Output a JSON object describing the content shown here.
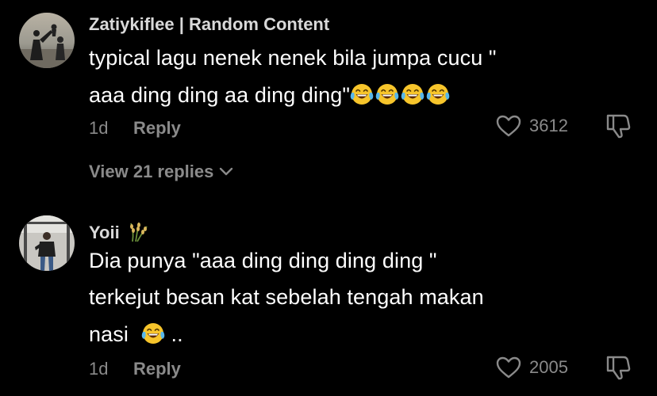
{
  "comments": [
    {
      "username": "Zatiykiflee | Random Content",
      "line1": "typical lagu nenek nenek bila jumpa cucu \"",
      "line2": "aaa ding ding aa ding ding\"",
      "time": "1d",
      "reply_label": "Reply",
      "likes": "3612",
      "view_replies": "View 21 replies"
    },
    {
      "username": "Yoii",
      "line1": "Dia punya \"aaa ding ding ding ding \"",
      "line2": "terkejut besan kat sebelah tengah makan",
      "line3_prefix": "nasi",
      "line3_suffix": "..",
      "time": "1d",
      "reply_label": "Reply",
      "likes": "2005"
    }
  ],
  "icons": {
    "like": "heart-outline-icon",
    "dislike": "thumbs-down-icon",
    "emoji": "face-with-tears-of-joy",
    "username_badge": "rice-sheaf"
  },
  "colors": {
    "background": "#000000",
    "text": "#ffffff",
    "username": "#d9d9d9",
    "meta": "#8a8a8a",
    "emoji_face": "#f7c52b",
    "emoji_tear": "#58b7ea"
  }
}
